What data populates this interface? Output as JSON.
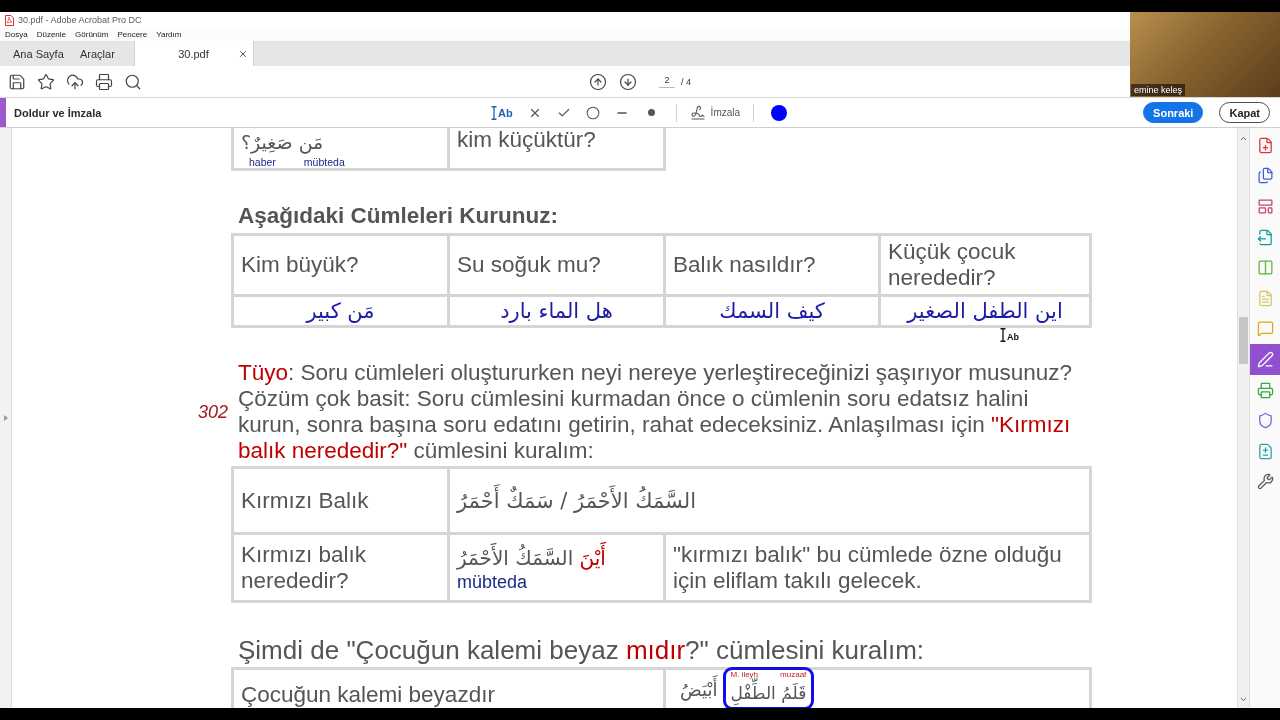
{
  "window": {
    "title": "30.pdf - Adobe Acrobat Pro DC"
  },
  "menu": [
    "Dosya",
    "Düzenle",
    "Görünüm",
    "Pencere",
    "Yardım"
  ],
  "tabs": [
    {
      "label": "Ana Sayfa",
      "selected": false,
      "closable": false
    },
    {
      "label": "Araçlar",
      "selected": false,
      "closable": false
    },
    {
      "label": "30.pdf",
      "selected": true,
      "closable": true
    }
  ],
  "page_nav": {
    "current": "2",
    "total": "/ 4"
  },
  "fill_sign_bar": {
    "title": "Doldur ve İmzala",
    "tools": [
      {
        "kind": "text",
        "label": "Ab",
        "selected": true
      },
      {
        "kind": "cross",
        "selected": false
      },
      {
        "kind": "check",
        "selected": false
      },
      {
        "kind": "circle",
        "selected": false
      },
      {
        "kind": "line",
        "selected": false
      },
      {
        "kind": "dot",
        "selected": false
      },
      {
        "kind": "sign",
        "label": "İmzala",
        "selected": false
      },
      {
        "kind": "color",
        "color": "#0000ff",
        "selected": false
      }
    ],
    "buttons": [
      {
        "label": "Sonraki",
        "kind": "primary"
      },
      {
        "label": "Kapat",
        "kind": "secondary"
      }
    ]
  },
  "video_tile": {
    "name": "emine keleş"
  },
  "document": {
    "previous_table": {
      "arabic": "مَن صَغِيرٌ؟",
      "notes": [
        "haber",
        "mübteda"
      ],
      "question": "kim küçüktür?"
    },
    "exercise": {
      "heading": "Aşağıdaki Cümleleri Kurunuz:",
      "questions": [
        "Kim büyük?",
        "Su soğuk mu?",
        "Balık nasıldır?",
        "Küçük çocuk nerededir?"
      ],
      "answers_rtl": [
        "اين الطفل الصغير",
        "كيف السمك",
        "هل الماء بارد",
        "مَن كبير"
      ]
    },
    "tip": {
      "page_number": "302",
      "segments": [
        {
          "text": "Tüyo",
          "highlight": true
        },
        {
          "text": ": Soru cümleleri oluştururken neyi nereye yerleştireceğinizi şaşırıyor musunuz? Çözüm çok basit: Soru cümlesini kurmadan önce o cümlenin soru edatsız halini kurun, sonra başına soru edatını getirin, rahat edeceksiniz. Anlaşılması için ",
          "highlight": false
        },
        {
          "text": "\"Kırmızı balık nerededir?\"",
          "highlight": true
        },
        {
          "text": " cümlesini kuralım:",
          "highlight": false
        }
      ]
    },
    "example_table": {
      "rows": [
        {
          "label": "Kırmızı Balık",
          "arabic": [
            {
              "text": "السَّمَكُ الأَحْمَرُ / سَمَكٌ أَحْمَرُ",
              "highlight": false
            }
          ]
        },
        {
          "label": "Kırmızı balık nerededir?",
          "arabic": [
            {
              "text": "أَيْنَ ",
              "highlight": true
            },
            {
              "text": "السَّمَكُ الأَحْمَرُ",
              "highlight": false
            }
          ],
          "note": "mübteda",
          "comment": "\"kırmızı balık\" bu cümlede özne olduğu için eliflam takılı gelecek."
        }
      ]
    },
    "second_heading": {
      "segments": [
        {
          "text": "Şimdi de \"Çocuğun kalemi beyaz ",
          "highlight": false
        },
        {
          "text": "mıdır",
          "highlight": true
        },
        {
          "text": "?\" cümlesini kuralım:",
          "highlight": false
        }
      ]
    },
    "last_table": {
      "label": "Çocuğun kalemi beyazdır",
      "arabic": "أَبْيَضُ",
      "framed": {
        "arabic": "قَلَمُ الطِّفْلِ",
        "notes": [
          "M. ileyh",
          "muzaaf"
        ]
      }
    },
    "cursor": {
      "label": "Ab"
    }
  },
  "tools_panel": [
    {
      "selected": false
    },
    {
      "selected": false
    },
    {
      "selected": false
    },
    {
      "selected": false
    },
    {
      "selected": false
    },
    {
      "selected": false
    },
    {
      "selected": false
    },
    {
      "selected": true
    },
    {
      "selected": false
    },
    {
      "selected": false
    },
    {
      "selected": false
    },
    {
      "selected": false
    }
  ]
}
